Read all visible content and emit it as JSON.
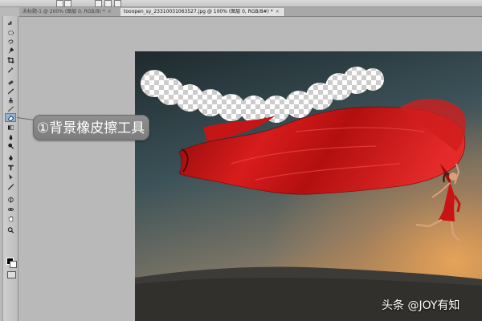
{
  "tabs": [
    {
      "label": "未标题-1 @ 200% (图层 0, RGB/8) *",
      "close": "×",
      "active": false
    },
    {
      "label": "tooopen_sy_233100310635​27.jpg @ 100% (图层 0, RGB/8#) *",
      "close": "×",
      "active": true
    }
  ],
  "tools": [
    "move-icon",
    "marquee-icon",
    "lasso-icon",
    "quick-select-icon",
    "crop-icon",
    "eyedropper-icon",
    "healing-brush-icon",
    "brush-icon",
    "clone-stamp-icon",
    "history-brush-icon",
    "eraser-icon",
    "gradient-icon",
    "blur-icon",
    "dodge-icon",
    "pen-icon",
    "type-icon",
    "path-select-icon",
    "line-icon",
    "3d-rotate-icon",
    "3d-orbit-icon",
    "hand-icon",
    "zoom-icon"
  ],
  "active_tool": "eraser-icon",
  "annotation": {
    "callout_text": "①背景橡皮擦工具"
  },
  "watermark": {
    "text": "头条 @JOY有知"
  },
  "colors": {
    "foreground": "#000000",
    "background": "#ffffff",
    "callout_bg": "#858585",
    "silk_red": "#c81414"
  }
}
